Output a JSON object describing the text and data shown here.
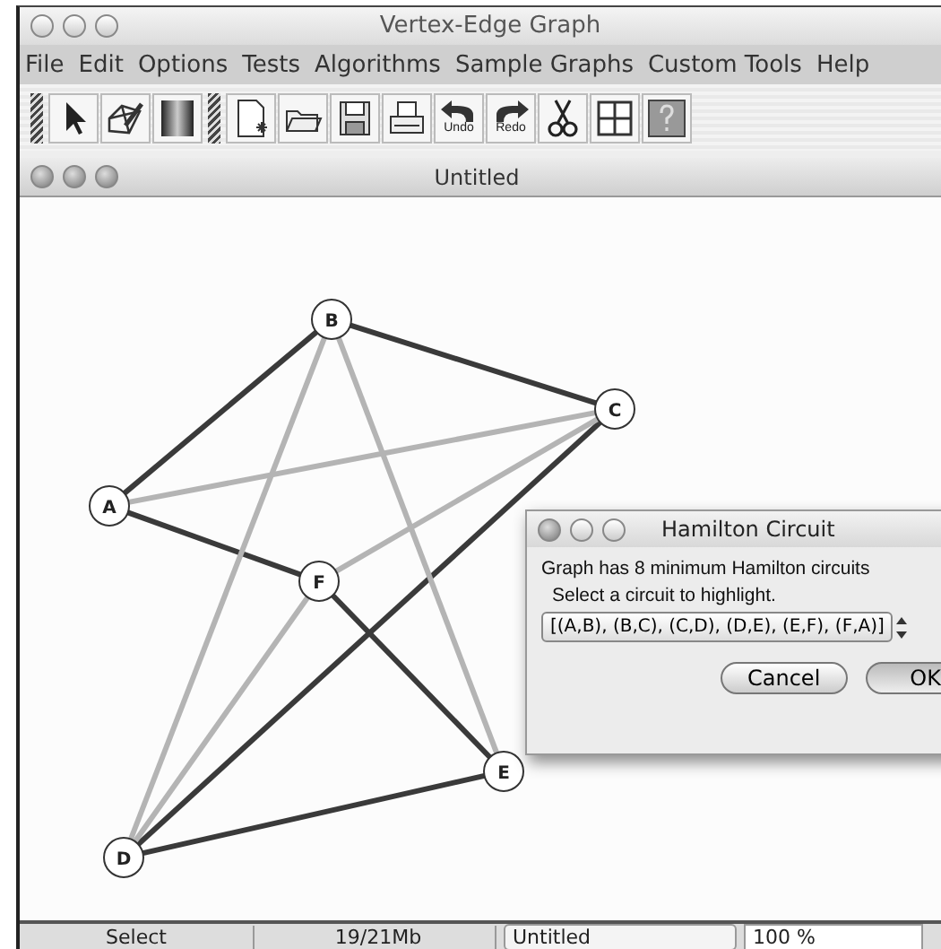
{
  "window": {
    "title": "Vertex-Edge Graph"
  },
  "menu": [
    "File",
    "Edit",
    "Options",
    "Tests",
    "Algorithms",
    "Sample Graphs",
    "Custom Tools",
    "Help"
  ],
  "toolbar": [
    {
      "kind": "grip"
    },
    {
      "kind": "select"
    },
    {
      "kind": "draw"
    },
    {
      "kind": "gradient"
    },
    {
      "kind": "grip"
    },
    {
      "kind": "new"
    },
    {
      "kind": "open"
    },
    {
      "kind": "save"
    },
    {
      "kind": "print"
    },
    {
      "kind": "undo",
      "label": "Undo"
    },
    {
      "kind": "redo",
      "label": "Redo"
    },
    {
      "kind": "cut"
    },
    {
      "kind": "grid"
    },
    {
      "kind": "help"
    }
  ],
  "document": {
    "title": "Untitled"
  },
  "graph": {
    "nodes": [
      {
        "label": "A"
      },
      {
        "label": "B"
      },
      {
        "label": "C"
      },
      {
        "label": "D"
      },
      {
        "label": "E"
      },
      {
        "label": "F"
      }
    ],
    "edges": [
      {
        "highlighted": true
      },
      {
        "highlighted": true
      },
      {
        "highlighted": true
      },
      {
        "highlighted": true
      },
      {
        "highlighted": true
      },
      {
        "highlighted": true
      },
      {
        "highlighted": false
      },
      {
        "highlighted": false
      },
      {
        "highlighted": false
      },
      {
        "highlighted": false
      },
      {
        "highlighted": false
      }
    ]
  },
  "dialog": {
    "title": "Hamilton Circuit",
    "message": "Graph has 8 minimum Hamilton circuits",
    "prompt": "Select a circuit to highlight.",
    "selection": "[(A,B), (B,C), (C,D), (D,E), (E,F), (F,A)]",
    "buttons": [
      {
        "label": "Cancel",
        "default": false
      },
      {
        "label": "OK",
        "default": true
      }
    ]
  },
  "status_bar": {
    "mode": "Select",
    "memory": "19/21Mb",
    "document": "Untitled",
    "zoom": "100 %"
  }
}
